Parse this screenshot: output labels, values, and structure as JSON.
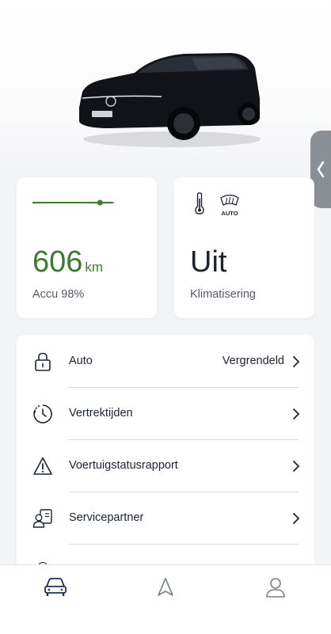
{
  "range_card": {
    "value": "606",
    "unit": "km",
    "battery_label": "Accu 98%",
    "battery_level": 0.98
  },
  "climate_card": {
    "value": "Uit",
    "label": "Klimatisering",
    "defrost_badge": "AUTO"
  },
  "list": {
    "items": [
      {
        "label": "Auto",
        "value": "Vergrendeld",
        "icon": "lock-icon"
      },
      {
        "label": "Vertrektijden",
        "value": "",
        "icon": "clock-icon"
      },
      {
        "label": "Voertuigstatusrapport",
        "value": "",
        "icon": "warning-icon"
      },
      {
        "label": "Servicepartner",
        "value": "",
        "icon": "service-partner-icon"
      }
    ]
  },
  "bottom_nav": [
    "car-icon",
    "navigation-icon",
    "profile-icon"
  ],
  "colors": {
    "accent_green": "#3d7a2e",
    "text_dark": "#1c2433"
  }
}
